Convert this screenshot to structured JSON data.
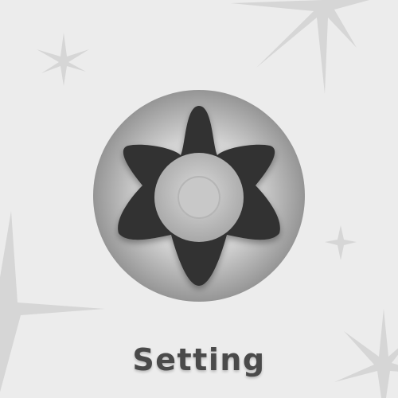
{
  "app": {
    "icon_name": "gear-icon",
    "label": "Setting"
  },
  "colors": {
    "background": "#ececec",
    "sparkle": "#d6d6d6",
    "disc_light": "#e6e6e6",
    "disc_dark": "#979797",
    "gear": "#333333",
    "gear_hub": "#c7c7c7",
    "label": "#4a4a4a"
  }
}
